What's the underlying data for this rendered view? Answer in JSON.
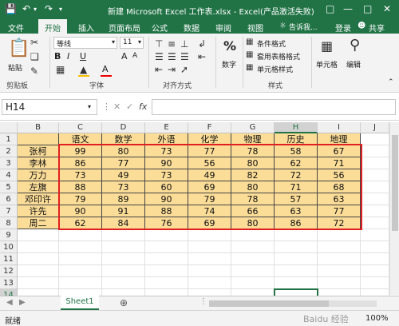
{
  "titlebar": {
    "save_icon": "save-icon",
    "undo_icon": "undo-icon",
    "redo_icon": "redo-icon",
    "title": "新建 Microsoft Excel 工作表.xlsx - Excel(产品激活失败)"
  },
  "tabs": [
    "文件",
    "开始",
    "插入",
    "页面布局",
    "公式",
    "数据",
    "审阅",
    "视图"
  ],
  "active_tab": "开始",
  "tell_me": "告诉我...",
  "login": "登录",
  "share": "共享",
  "ribbon": {
    "paste": "粘贴",
    "clipboard": "剪贴板",
    "font_name": "等线",
    "font_size": "11",
    "font_group": "字体",
    "bold": "B",
    "italic": "I",
    "underline": "U",
    "grow_font": "A",
    "shrink_font": "A",
    "align_group": "对齐方式",
    "number": "数字",
    "conditional": "条件格式",
    "table_format": "套用表格格式",
    "cell_style": "单元格样式",
    "styles_group": "样式",
    "cells": "单元格",
    "edit": "编辑",
    "percent": "%"
  },
  "formula_bar": {
    "name_box": "H14",
    "fx": "fx",
    "cancel": "✕",
    "confirm": "✓",
    "value": ""
  },
  "columns": [
    "B",
    "C",
    "D",
    "E",
    "F",
    "G",
    "H",
    "I",
    "J"
  ],
  "rows": [
    "1",
    "2",
    "3",
    "4",
    "5",
    "6",
    "7",
    "8",
    "9",
    "10",
    "11",
    "12",
    "13",
    "14",
    "15"
  ],
  "table": {
    "headers": [
      "语文",
      "数学",
      "外语",
      "化学",
      "物理",
      "历史",
      "地理"
    ],
    "rows": [
      {
        "name": "张柯",
        "values": [
          "99",
          "80",
          "73",
          "77",
          "78",
          "58",
          "67"
        ]
      },
      {
        "name": "李林",
        "values": [
          "86",
          "77",
          "90",
          "56",
          "80",
          "62",
          "71"
        ]
      },
      {
        "name": "万力",
        "values": [
          "73",
          "49",
          "73",
          "49",
          "82",
          "72",
          "56"
        ]
      },
      {
        "name": "左旗",
        "values": [
          "88",
          "73",
          "60",
          "69",
          "80",
          "71",
          "68"
        ]
      },
      {
        "name": "邓印许",
        "values": [
          "79",
          "89",
          "90",
          "79",
          "78",
          "57",
          "63"
        ]
      },
      {
        "name": "许先",
        "values": [
          "90",
          "91",
          "88",
          "74",
          "66",
          "63",
          "77"
        ]
      },
      {
        "name": "周二",
        "values": [
          "62",
          "84",
          "76",
          "69",
          "80",
          "86",
          "72"
        ]
      }
    ]
  },
  "sheet_tab": "Sheet1",
  "status": {
    "ready": "就绪",
    "zoom": "100%",
    "watermark": "Baidu 经验"
  },
  "colors": {
    "accent": "#217346",
    "cell_fill": "#fbdd98",
    "highlight_border": "#e02020"
  }
}
